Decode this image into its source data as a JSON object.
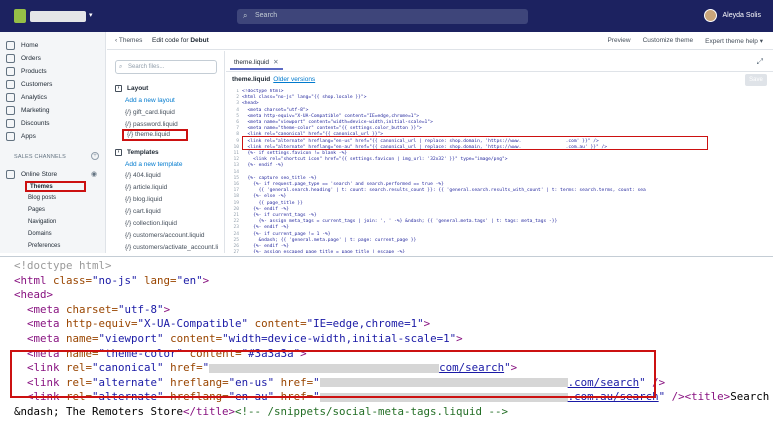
{
  "topbar": {
    "search_placeholder": "Search",
    "user_name": "Aleyda Solis",
    "store_caret": "▾"
  },
  "sidebar": {
    "items": [
      {
        "label": "Home",
        "icon": "home-icon"
      },
      {
        "label": "Orders",
        "icon": "orders-icon"
      },
      {
        "label": "Products",
        "icon": "products-icon"
      },
      {
        "label": "Customers",
        "icon": "customers-icon"
      },
      {
        "label": "Analytics",
        "icon": "analytics-icon"
      },
      {
        "label": "Marketing",
        "icon": "marketing-icon"
      },
      {
        "label": "Discounts",
        "icon": "discounts-icon"
      },
      {
        "label": "Apps",
        "icon": "apps-icon"
      }
    ],
    "sales_channels_label": "SALES CHANNELS",
    "online_store": "Online Store",
    "sub_items": [
      "Themes",
      "Blog posts",
      "Pages",
      "Navigation",
      "Domains",
      "Preferences"
    ]
  },
  "editor_header": {
    "back": "Themes",
    "editing_prefix": "Edit code for",
    "theme_name": "Debut",
    "actions": [
      "Preview",
      "Customize theme",
      "Expert theme help ▾"
    ]
  },
  "file_panel": {
    "search_placeholder": "Search files...",
    "layout_label": "Layout",
    "add_layout": "Add a new layout",
    "layout_files": [
      "gift_card.liquid",
      "password.liquid",
      "theme.liquid"
    ],
    "templates_label": "Templates",
    "add_template": "Add a new template",
    "template_files": [
      "404.liquid",
      "article.liquid",
      "blog.liquid",
      "cart.liquid",
      "collection.liquid",
      "customers/account.liquid",
      "customers/activate_account.li"
    ]
  },
  "editor": {
    "tab_name": "theme.liquid",
    "file_title": "theme.liquid",
    "older_versions": "Older versions",
    "save": "Save",
    "lines": [
      "<!doctype html>",
      "<html class=\"no-js\" lang=\"{{ shop.locale }}\">",
      "<head>",
      "  <meta charset=\"utf-8\">",
      "  <meta http-equiv=\"X-UA-Compatible\" content=\"IE=edge,chrome=1\">",
      "  <meta name=\"viewport\" content=\"width=device-width,initial-scale=1\">",
      "  <meta name=\"theme-color\" content=\"{{ settings.color_button }}\">",
      "  <link rel=\"canonical\" href=\"{{ canonical_url }}\">",
      "  <link rel=\"alternate\" hreflang=\"en-us\" href=\"{{ canonical_url | replace: shop.domain, 'https://www.                .com' }}\" />",
      "  <link rel=\"alternate\" hreflang=\"en-au\" href=\"{{ canonical_url | replace: shop.domain, 'https://www.                .com.au' }}\" />",
      "  {%- if settings.favicon != blank -%}",
      "    <link rel=\"shortcut icon\" href=\"{{ settings.favicon | img_url: '32x32' }}\" type=\"image/png\">",
      "  {%- endif -%}",
      "",
      "  {%- capture seo_title -%}",
      "    {%- if request.page_type == 'search' and search.performed == true -%}",
      "      {{ 'general.search.heading' | t: count: search.results_count }}: {{ 'general.search.results_with_count' | t: terms: search.terms, count: sea",
      "    {%- else -%}",
      "      {{ page_title }}",
      "    {%- endif -%}",
      "    {%- if current_tags -%}",
      "      {%- assign meta_tags = current_tags | join: ', ' -%} &ndash; {{ 'general.meta.tags' | t: tags: meta_tags -}}",
      "    {%- endif -%}",
      "    {%- if current_page != 1 -%}",
      "      &ndash; {{ 'general.meta.page' | t: page: current_page }}",
      "    {%- endif -%}",
      "    {%- assign escaped_page_title = page_title | escape -%}",
      "    {%- unless escaped_page_title contains shop.name -%}"
    ]
  },
  "zoom": {
    "doctype": "<!doctype html>",
    "html_open": "<html",
    "class_attr": " class=",
    "class_val": "\"no-js\"",
    "lang_attr": " lang=",
    "lang_val": "\"en\"",
    "close": ">",
    "head": "<head>",
    "meta": "<meta",
    "charset_attr": " charset=",
    "charset_val": "\"utf-8\"",
    "http_equiv_attr": " http-equiv=",
    "http_equiv_val": "\"X-UA-Compatible\"",
    "content_attr": " content=",
    "content_ie_val": "\"IE=edge,chrome=1\"",
    "name_attr": " name=",
    "viewport_val": "\"viewport\"",
    "viewport_content": "\"width=device-width,initial-scale=1\"",
    "theme_color_name": "\"theme-color\"",
    "theme_color_val": "\"#3a3a3a\"",
    "link": "<link",
    "rel_attr": " rel=",
    "canonical_val": "\"canonical\"",
    "alternate_val": "\"alternate\"",
    "href_attr": " href=",
    "hreflang_attr": " hreflang=",
    "en_us": "\"en-us\"",
    "en_au": "\"en-au\"",
    "quote": "\"",
    "canon_url_tail": "com/search",
    "us_url_tail": ".com/search",
    "au_url_tail": ".com.au/search",
    "self_close": " />",
    "title_open": "<title>",
    "title_text_a": "Search",
    "title_text_b": "&ndash; The Remoters Store",
    "title_close": "</title>",
    "comment": "<!-- /snippets/social-meta-tags.liquid -->"
  }
}
